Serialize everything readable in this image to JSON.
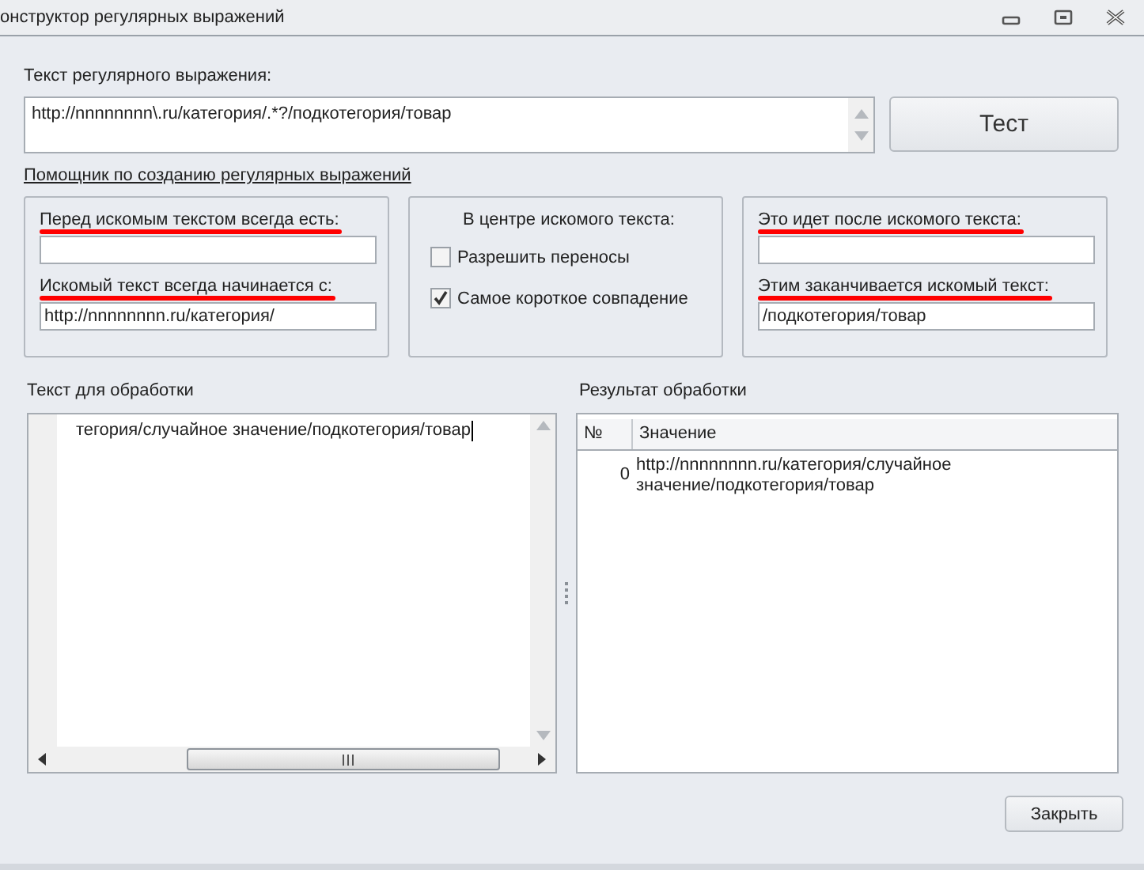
{
  "window": {
    "title": "онструктор регулярных выражений"
  },
  "regex": {
    "label": "Текст регулярного выражения:",
    "value": "http://nnnnnnnn\\.ru/категория/.*?/подкотегория/товар"
  },
  "test_button": "Тест",
  "helper_link": "Помощник по созданию регулярных выражений",
  "left_group": [
    {
      "label": "Перед искомым текстом всегда есть:",
      "highlighted": true
    },
    {
      "label": "Искомый текст всегда начинается с:",
      "highlighted": true,
      "value": "http://nnnnnnnn.ru/категория/"
    }
  ],
  "center_group": {
    "title": "В центре искомого текста:",
    "options": [
      {
        "label": "Разрешить переносы",
        "checked": false
      },
      {
        "label": "Самое короткое совпадение",
        "checked": true
      }
    ]
  },
  "right_group": [
    {
      "label": "Это идет после искомого текста:",
      "highlighted": true
    },
    {
      "label": "Этим заканчивается искомый текст:",
      "highlighted": true,
      "value": "/подкотегория/товар"
    }
  ],
  "input_text": {
    "label": "Текст для обработки",
    "value": "тегория/случайное значение/подкотегория/товар"
  },
  "result": {
    "label": "Результат обработки",
    "columns": [
      "№",
      "Значение"
    ],
    "rows": [
      {
        "index": "0",
        "value": "http://nnnnnnnn.ru/категория/случайное значение/подкотегория/товар"
      }
    ]
  },
  "close_button": "Закрыть"
}
